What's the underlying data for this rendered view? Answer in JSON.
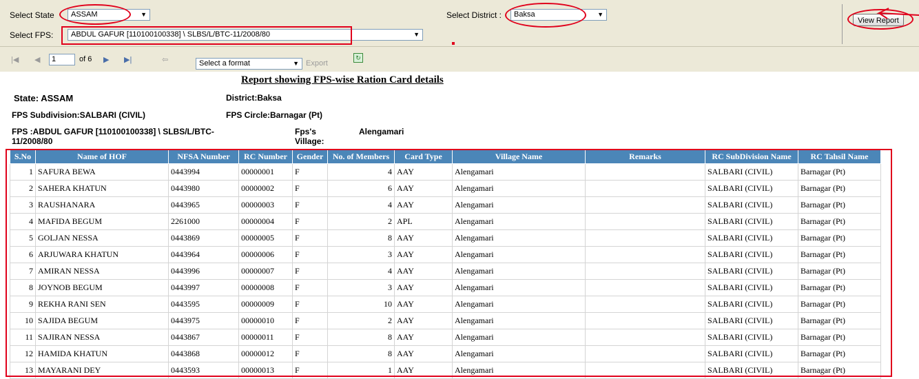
{
  "params": {
    "state_label": "Select State",
    "state_value": "ASSAM",
    "district_label": "Select District :",
    "district_value": "Baksa",
    "fps_label": "Select FPS:",
    "fps_value": "ABDUL GAFUR [110100100338] \\ SLBS/L/BTC-11/2008/80",
    "view_report": "View Report"
  },
  "toolbar": {
    "page": "1",
    "of_pages": "of 6",
    "format_placeholder": "Select a format",
    "export_label": "Export"
  },
  "report": {
    "title": "Report showing FPS-wise Ration Card details",
    "state": "State: ASSAM",
    "district": "District:Baksa",
    "fps_subdivision": "FPS Subdivision:SALBARI (CIVIL)",
    "fps_circle": "FPS Circle:Barnagar (Pt)",
    "fps_line1": "FPS :ABDUL GAFUR [110100100338] \\ SLBS/L/BTC-",
    "fps_line2": "11/2008/80",
    "fps_village_label1": "Fps's",
    "fps_village_label2": "Village:",
    "fps_village_value": "Alengamari"
  },
  "table": {
    "headers": [
      "S.No",
      "Name of  HOF",
      "NFSA Number",
      "RC Number",
      "Gender",
      "No. of Members",
      "Card Type",
      "Village Name",
      "Remarks",
      "RC SubDivision Name",
      "RC Tahsil Name"
    ],
    "rows": [
      [
        "1",
        "SAFURA BEWA",
        "0443994",
        "00000001",
        "F",
        "4",
        "AAY",
        "Alengamari",
        "",
        "SALBARI (CIVIL)",
        "Barnagar (Pt)"
      ],
      [
        "2",
        "SAHERA KHATUN",
        "0443980",
        "00000002",
        "F",
        "6",
        "AAY",
        "Alengamari",
        "",
        "SALBARI (CIVIL)",
        "Barnagar (Pt)"
      ],
      [
        "3",
        "RAUSHANARA",
        "0443965",
        "00000003",
        "F",
        "4",
        "AAY",
        "Alengamari",
        "",
        "SALBARI (CIVIL)",
        "Barnagar (Pt)"
      ],
      [
        "4",
        "MAFIDA BEGUM",
        "2261000",
        "00000004",
        "F",
        "2",
        "APL",
        "Alengamari",
        "",
        "SALBARI (CIVIL)",
        "Barnagar (Pt)"
      ],
      [
        "5",
        "GOLJAN NESSA",
        "0443869",
        "00000005",
        "F",
        "8",
        "AAY",
        "Alengamari",
        "",
        "SALBARI (CIVIL)",
        "Barnagar (Pt)"
      ],
      [
        "6",
        "ARJUWARA KHATUN",
        "0443964",
        "00000006",
        "F",
        "3",
        "AAY",
        "Alengamari",
        "",
        "SALBARI (CIVIL)",
        "Barnagar (Pt)"
      ],
      [
        "7",
        "AMIRAN NESSA",
        "0443996",
        "00000007",
        "F",
        "4",
        "AAY",
        "Alengamari",
        "",
        "SALBARI (CIVIL)",
        "Barnagar (Pt)"
      ],
      [
        "8",
        "JOYNOB BEGUM",
        "0443997",
        "00000008",
        "F",
        "3",
        "AAY",
        "Alengamari",
        "",
        "SALBARI (CIVIL)",
        "Barnagar (Pt)"
      ],
      [
        "9",
        "REKHA RANI SEN",
        "0443595",
        "00000009",
        "F",
        "10",
        "AAY",
        "Alengamari",
        "",
        "SALBARI (CIVIL)",
        "Barnagar (Pt)"
      ],
      [
        "10",
        "SAJIDA BEGUM",
        "0443975",
        "00000010",
        "F",
        "2",
        "AAY",
        "Alengamari",
        "",
        "SALBARI (CIVIL)",
        "Barnagar (Pt)"
      ],
      [
        "11",
        "SAJIRAN NESSA",
        "0443867",
        "00000011",
        "F",
        "8",
        "AAY",
        "Alengamari",
        "",
        "SALBARI (CIVIL)",
        "Barnagar (Pt)"
      ],
      [
        "12",
        "HAMIDA KHATUN",
        "0443868",
        "00000012",
        "F",
        "8",
        "AAY",
        "Alengamari",
        "",
        "SALBARI (CIVIL)",
        "Barnagar (Pt)"
      ],
      [
        "13",
        "MAYARANI DEY",
        "0443593",
        "00000013",
        "F",
        "1",
        "AAY",
        "Alengamari",
        "",
        "SALBARI (CIVIL)",
        "Barnagar (Pt)"
      ]
    ]
  },
  "colors": {
    "header_bg": "#4b86b8",
    "annotation_red": "#e0001b",
    "param_bg": "#ECE9D8"
  }
}
